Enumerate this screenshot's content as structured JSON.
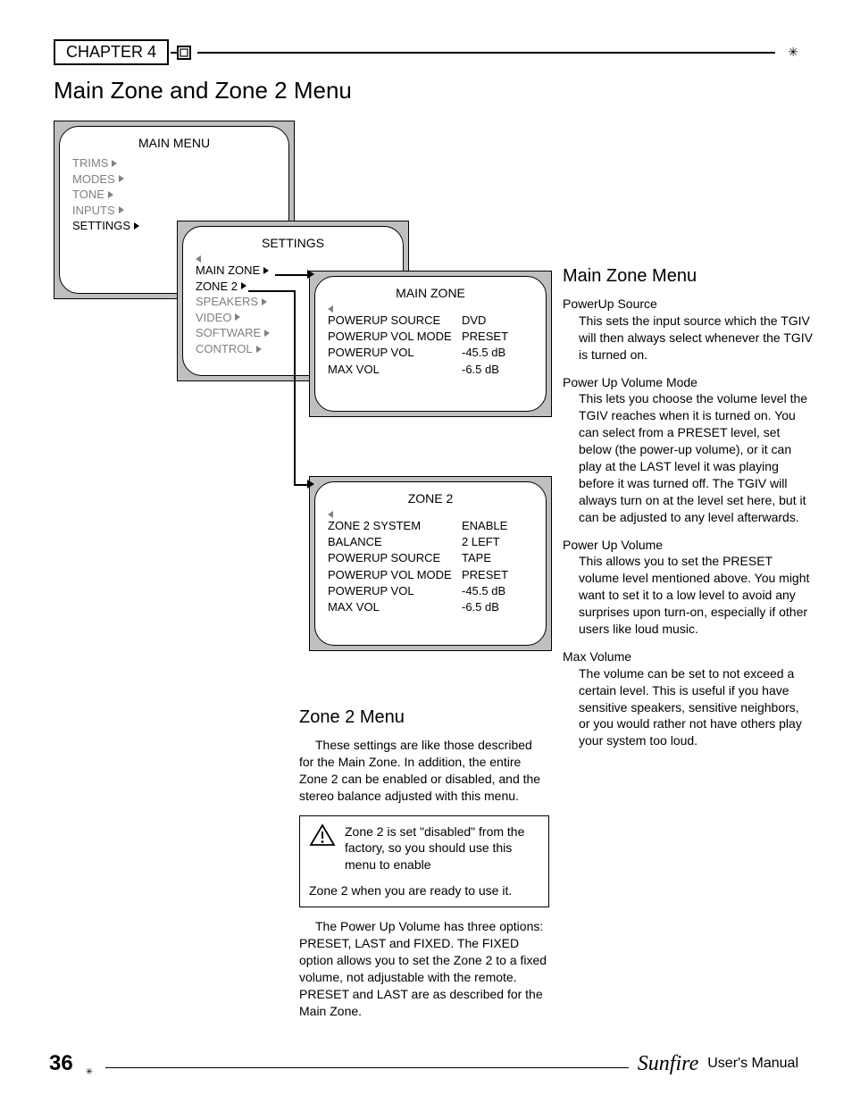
{
  "chapter": "CHAPTER 4",
  "page_title": "Main Zone and Zone 2 Menu",
  "main_menu": {
    "title": "MAIN MENU",
    "items": [
      "TRIMS",
      "MODES",
      "TONE",
      "INPUTS",
      "SETTINGS"
    ],
    "active_index": 4
  },
  "settings_menu": {
    "title": "SETTINGS",
    "items": [
      "MAIN ZONE",
      "ZONE 2",
      "SPEAKERS",
      "VIDEO",
      "SOFTWARE",
      "CONTROL"
    ],
    "active_indices": [
      0,
      1
    ]
  },
  "main_zone_panel": {
    "title": "MAIN ZONE",
    "rows": [
      {
        "k": "POWERUP SOURCE",
        "v": "DVD"
      },
      {
        "k": "POWERUP VOL MODE",
        "v": "PRESET"
      },
      {
        "k": "POWERUP VOL",
        "v": "-45.5 dB"
      },
      {
        "k": "MAX VOL",
        "v": "-6.5 dB"
      }
    ]
  },
  "zone2_panel": {
    "title": "ZONE 2",
    "rows": [
      {
        "k": "ZONE 2 SYSTEM",
        "v": "ENABLE"
      },
      {
        "k": "BALANCE",
        "v": "2 LEFT"
      },
      {
        "k": "POWERUP SOURCE",
        "v": "TAPE"
      },
      {
        "k": "POWERUP VOL MODE",
        "v": "PRESET"
      },
      {
        "k": "POWERUP VOL",
        "v": "-45.5 dB"
      },
      {
        "k": "MAX VOL",
        "v": "-6.5 dB"
      }
    ]
  },
  "right": {
    "heading": "Main Zone Menu",
    "entries": [
      {
        "name": "PowerUp Source",
        "desc": "This sets the input source which the TGIV will then always select whenever the TGIV is turned on."
      },
      {
        "name": "Power Up Volume Mode",
        "desc": "This lets you choose the volume level the TGIV reaches when it is turned on. You can select from a PRESET level, set below (the power-up volume), or it can play at the LAST level it was playing before it was turned off. The TGIV will always turn on at the level set here, but it can be adjusted to any level afterwards."
      },
      {
        "name": "Power Up Volume",
        "desc": "This allows you to set the PRESET volume level mentioned above. You might want to set it to a low level to avoid any surprises upon turn-on, especially if other users like loud music."
      },
      {
        "name": "Max Volume",
        "desc": "The volume can be set to not exceed a certain level. This is useful if you have sensitive speakers, sensitive neighbors, or you would rather not have others play your system too loud."
      }
    ]
  },
  "left_text": {
    "heading": "Zone 2 Menu",
    "para1": "These settings are like those described for the Main Zone. In addition, the entire Zone 2 can be enabled or disabled, and the stereo balance adjusted with this menu.",
    "notice_top": "Zone 2 is set \"disabled\" from the factory, so you should use this menu to enable",
    "notice_bottom": "Zone 2 when you are ready to use it.",
    "para2": "The Power Up Volume has three options: PRESET, LAST and FIXED. The FIXED option allows you to set the Zone 2 to a fixed volume, not adjustable with the remote. PRESET and LAST are as described for the Main Zone."
  },
  "footer": {
    "page": "36",
    "brand": "Sunfire",
    "manual": "User's Manual"
  }
}
